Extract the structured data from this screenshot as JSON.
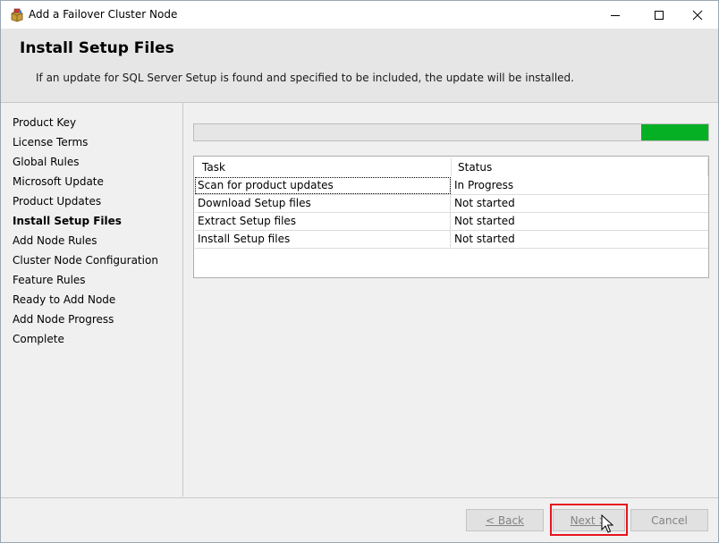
{
  "window": {
    "title": "Add a Failover Cluster Node"
  },
  "header": {
    "title": "Install Setup Files",
    "description": "If an update for SQL Server Setup is found and specified to be included, the update will be installed."
  },
  "sidebar": {
    "items": [
      {
        "label": "Product Key",
        "active": false
      },
      {
        "label": "License Terms",
        "active": false
      },
      {
        "label": "Global Rules",
        "active": false
      },
      {
        "label": "Microsoft Update",
        "active": false
      },
      {
        "label": "Product Updates",
        "active": false
      },
      {
        "label": "Install Setup Files",
        "active": true
      },
      {
        "label": "Add Node Rules",
        "active": false
      },
      {
        "label": "Cluster Node Configuration",
        "active": false
      },
      {
        "label": "Feature Rules",
        "active": false
      },
      {
        "label": "Ready to Add Node",
        "active": false
      },
      {
        "label": "Add Node Progress",
        "active": false
      },
      {
        "label": "Complete",
        "active": false
      }
    ]
  },
  "progress": {
    "fill_start_fraction": 0.87,
    "fill_end_fraction": 1.0,
    "color": "#06b025"
  },
  "table": {
    "columns": [
      "Task",
      "Status"
    ],
    "rows": [
      {
        "task": "Scan for product updates",
        "status": "In Progress"
      },
      {
        "task": "Download Setup files",
        "status": "Not started"
      },
      {
        "task": "Extract Setup files",
        "status": "Not started"
      },
      {
        "task": "Install Setup files",
        "status": "Not started"
      }
    ]
  },
  "footer": {
    "back_label": "< Back",
    "next_label": "Next >",
    "cancel_label": "Cancel"
  },
  "colors": {
    "highlight": "#e8141d",
    "accent_green": "#06b025"
  }
}
